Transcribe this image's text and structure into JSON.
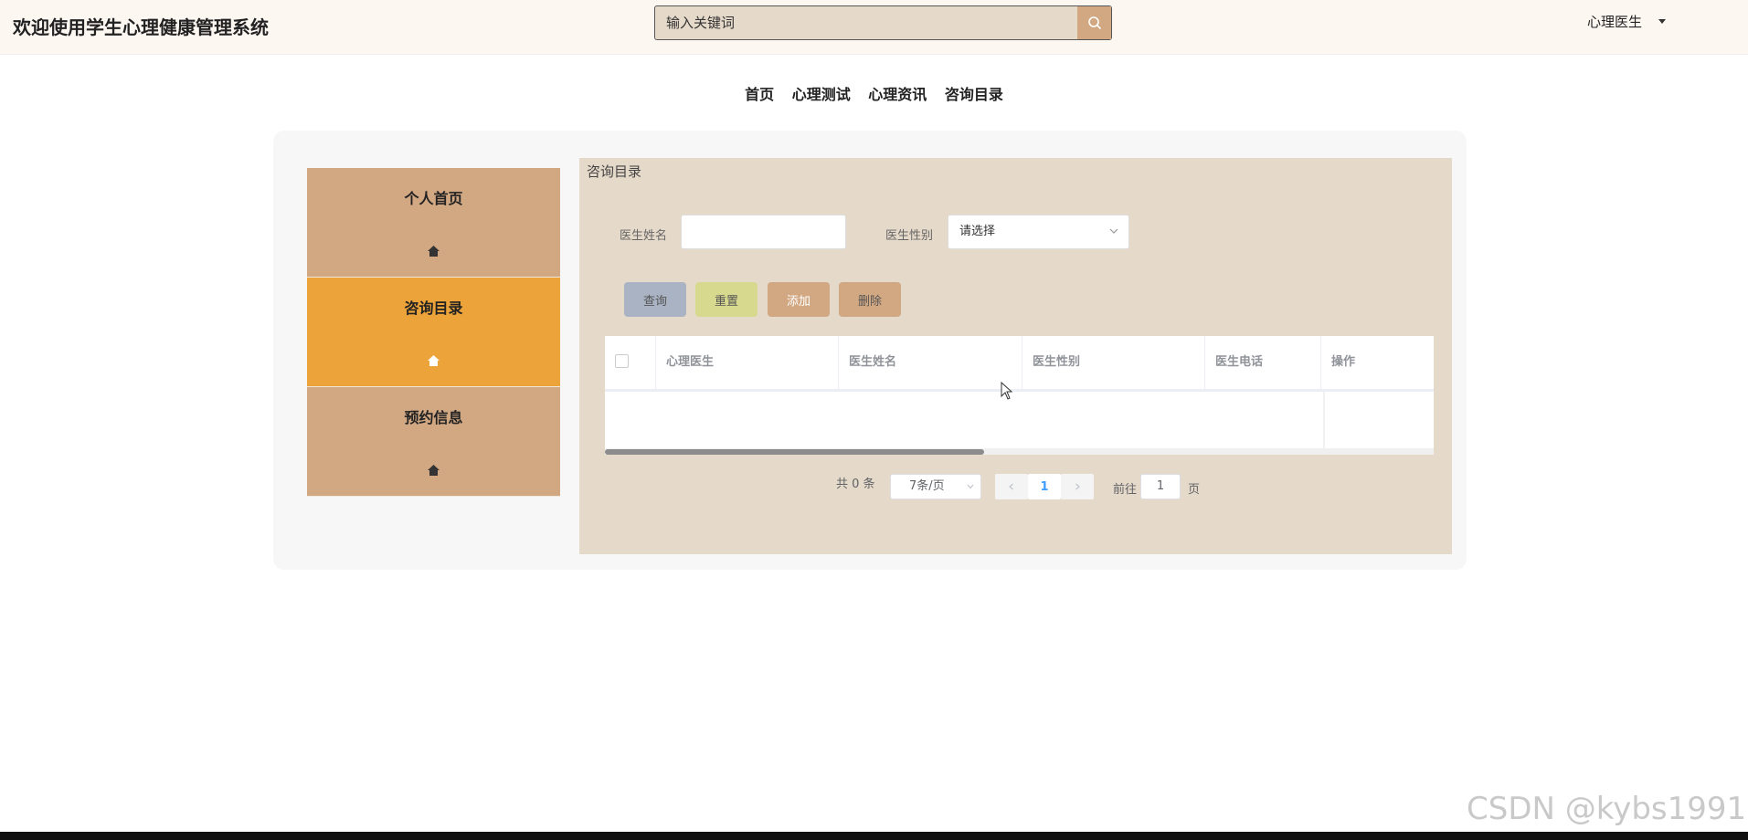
{
  "header": {
    "title": "欢迎使用学生心理健康管理系统",
    "search_placeholder": "输入关键词",
    "user_label": "心理医生"
  },
  "nav": [
    "首页",
    "心理测试",
    "心理资讯",
    "咨询目录"
  ],
  "sidebar": {
    "items": [
      {
        "label": "个人首页",
        "icon": "home-icon",
        "active": false
      },
      {
        "label": "咨询目录",
        "icon": "home-icon",
        "active": true
      },
      {
        "label": "预约信息",
        "icon": "home-icon",
        "active": false
      }
    ],
    "active_color": "#eca33a",
    "item_color": "#d2a883"
  },
  "content": {
    "title": "咨询目录",
    "filters": {
      "name_label": "医生姓名",
      "name_value": "",
      "gender_label": "医生性别",
      "gender_placeholder": "请选择"
    },
    "buttons": {
      "query": "查询",
      "reset": "重置",
      "add": "添加",
      "delete": "删除"
    },
    "table": {
      "columns": [
        "心理医生",
        "医生姓名",
        "医生性别",
        "医生电话",
        "操作"
      ],
      "rows": []
    },
    "pagination": {
      "total_text": "共 0 条",
      "page_size": "7条/页",
      "current_page": "1",
      "goto_label": "前往",
      "goto_value": "1",
      "page_suffix": "页"
    }
  },
  "watermark": "CSDN @kybs1991"
}
